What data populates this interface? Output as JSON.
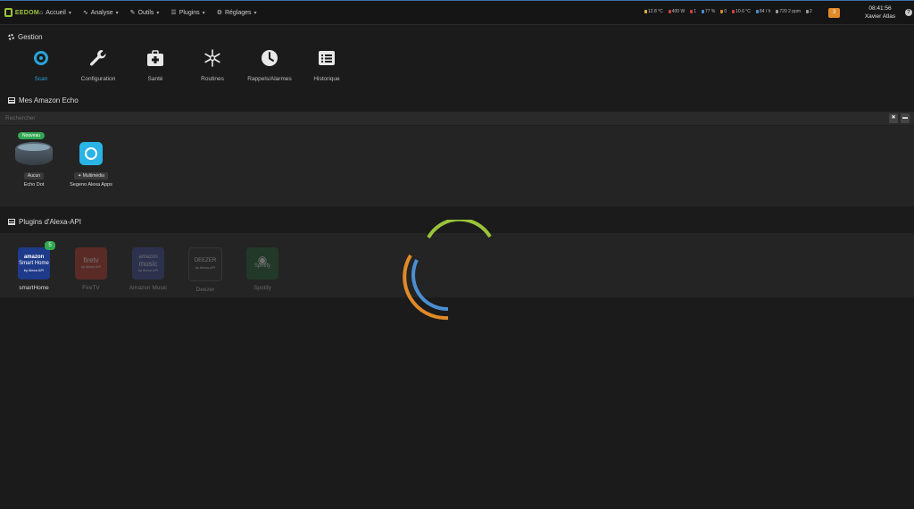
{
  "navbar": {
    "logo_text": "EEDOM",
    "menu": [
      {
        "label": "Accueil",
        "icon": "home-icon"
      },
      {
        "label": "Analyse",
        "icon": "analytics-icon"
      },
      {
        "label": "Outils",
        "icon": "wrench-icon"
      },
      {
        "label": "Plugins",
        "icon": "list-icon"
      },
      {
        "label": "Réglages",
        "icon": "gear-icon"
      }
    ],
    "status": [
      {
        "text": "12.8 °C",
        "color": "#e0b040"
      },
      {
        "text": "400 W",
        "color": "#d04040"
      },
      {
        "text": "1",
        "color": "#d04040"
      },
      {
        "text": "77 %",
        "color": "#4a8fd0"
      },
      {
        "text": "0",
        "color": "#d08a30"
      },
      {
        "text": "10.6 °C",
        "color": "#d04040"
      },
      {
        "text": "84 / h",
        "color": "#4a8fd0"
      },
      {
        "text": "720 2 ppm",
        "color": "#999999"
      },
      {
        "text": "2",
        "color": "#999999"
      }
    ],
    "notif_count": "3",
    "time": "08:41:56",
    "user": "Xavier Atlas",
    "accent_color": "#9ac43a"
  },
  "gestion": {
    "title": "Gestion",
    "actions": [
      {
        "label": "Scan",
        "icon": "scan-icon",
        "active": true
      },
      {
        "label": "Configuration",
        "icon": "wrench-icon"
      },
      {
        "label": "Santé",
        "icon": "medkit-icon"
      },
      {
        "label": "Routines",
        "icon": "snowflake-icon"
      },
      {
        "label": "Rappels/Alarmes",
        "icon": "clock-icon"
      },
      {
        "label": "Historique",
        "icon": "list-icon"
      }
    ]
  },
  "echo": {
    "title": "Mes Amazon Echo",
    "search_placeholder": "Rechercher",
    "devices": [
      {
        "badge": "Nouveau",
        "tag": "Aucun",
        "name": "Echo Dot"
      },
      {
        "tag": "✦ Multimédia",
        "name": "Segeno Alexa Apps"
      }
    ]
  },
  "plugins": {
    "title": "Plugins d'Alexa-API",
    "items": [
      {
        "name": "smartHome",
        "tile_lines": [
          "amazon",
          "Smart Home",
          "by Alexa API"
        ],
        "count": "5",
        "bg": "#1e3a8a"
      },
      {
        "name": "FireTV",
        "tile_lines": [
          "firetv",
          "by Alexa API"
        ],
        "bg": "#c0392b"
      },
      {
        "name": "Amazon Music",
        "tile_lines": [
          "amazon",
          "music",
          "by Alexa API"
        ],
        "bg": "#3b4a9e"
      },
      {
        "name": "Deezer",
        "tile_lines": [
          "DEEZER",
          "by Alexa API"
        ],
        "bg": "#2b2b2b"
      },
      {
        "name": "Spotify",
        "tile_lines": [
          "Spotify"
        ],
        "bg": "#1f5e35"
      }
    ]
  },
  "spinner": {
    "colors": [
      "#9ac43a",
      "#4a8fd0",
      "#e08a28"
    ]
  }
}
